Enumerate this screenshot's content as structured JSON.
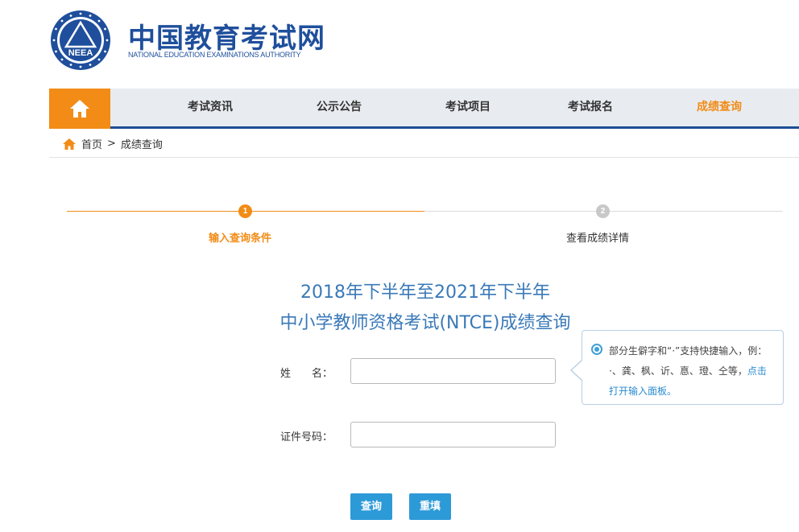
{
  "logo": {
    "emblem_text": "NEEA",
    "cn_name": "中国教育考试网",
    "en_name": "NATIONAL EDUCATION EXAMINATIONS AUTHORITY"
  },
  "nav": {
    "home_icon": "home-icon",
    "items": [
      {
        "label": "考试资讯"
      },
      {
        "label": "公示公告"
      },
      {
        "label": "考试项目"
      },
      {
        "label": "考试报名"
      },
      {
        "label": "成绩查询"
      }
    ]
  },
  "breadcrumb": {
    "home": "首页",
    "separator": ">",
    "current": "成绩查询"
  },
  "steps": [
    {
      "num": "1",
      "label": "输入查询条件"
    },
    {
      "num": "2",
      "label": "查看成绩详情"
    }
  ],
  "title": {
    "line1": "2018年下半年至2021年下半年",
    "line2": "中小学教师资格考试(NTCE)成绩查询"
  },
  "form": {
    "name_label": "姓　　名：",
    "name_value": "",
    "id_label": "证件号码：",
    "id_value": ""
  },
  "tooltip": {
    "text": "部分生僻字和“·”支持快捷输入，例：·、龚、枫、䜣、惪、璒、仝等，",
    "link": "点击打开输入面板。"
  },
  "buttons": {
    "query": "查询",
    "reset": "重填"
  },
  "colors": {
    "accent_orange": "#f28c16",
    "brand_blue": "#1d4d95",
    "title_blue": "#3a79b8",
    "button_blue": "#2d9ad8"
  }
}
